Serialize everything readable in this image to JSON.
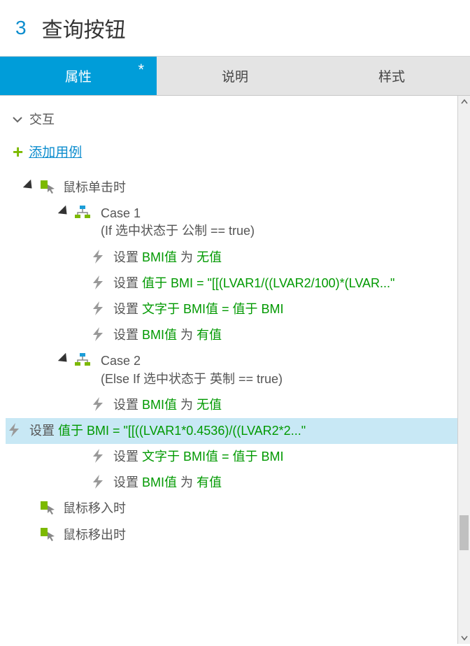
{
  "header": {
    "num": "3",
    "title": "查询按钮"
  },
  "tabs": {
    "t1": "属性",
    "t1_mod": "*",
    "t2": "说明",
    "t3": "样式"
  },
  "section": {
    "title": "交互"
  },
  "add": {
    "label": "添加用例"
  },
  "tree": {
    "event_click": "鼠标单击时",
    "event_enter": "鼠标移入时",
    "event_leave": "鼠标移出时",
    "case1": {
      "name": "Case 1",
      "cond": "(If 选中状态于 公制 == true)"
    },
    "case2": {
      "name": "Case 2",
      "cond": "(Else If 选中状态于 英制 == true)"
    },
    "a1": {
      "p": "设置 ",
      "g1": "BMI值",
      "m": " 为 ",
      "g2": "无值"
    },
    "a2": {
      "p": "设置 ",
      "g": "值于 BMI = \"[[(LVAR1/((LVAR2/100)*(LVAR...\""
    },
    "a3": {
      "p": "设置 ",
      "g": "文字于 BMI值 = 值于 BMI"
    },
    "a4": {
      "p": "设置 ",
      "g1": "BMI值",
      "m": " 为 ",
      "g2": "有值"
    },
    "a5": {
      "p": "设置 ",
      "g1": "BMI值",
      "m": " 为 ",
      "g2": "无值"
    },
    "a6": {
      "p": "设置 ",
      "g": "值于 BMI = \"[[((LVAR1*0.4536)/((LVAR2*2...\""
    },
    "a7": {
      "p": "设置 ",
      "g": "文字于 BMI值 = 值于 BMI"
    },
    "a8": {
      "p": "设置 ",
      "g1": "BMI值",
      "m": " 为 ",
      "g2": "有值"
    }
  }
}
